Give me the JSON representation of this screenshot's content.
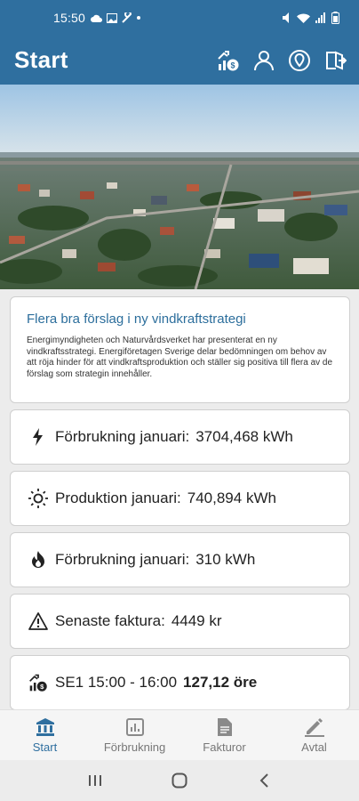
{
  "status_bar": {
    "time": "15:50",
    "left_icons": [
      "cloud-icon",
      "image-icon",
      "wrench-icon",
      "dot-icon"
    ],
    "right_icons": [
      "mute-icon",
      "wifi-icon",
      "signal-icon",
      "battery-icon"
    ]
  },
  "app_bar": {
    "title": "Start",
    "actions": [
      "price-chart-icon",
      "user-icon",
      "location-icon",
      "logout-icon"
    ]
  },
  "news": {
    "title": "Flera bra förslag i ny vindkraftstrategi",
    "body": "Energimyndigheten och Naturvårdsverket har presenterat en ny vindkraftsstrategi. Energiföretagen Sverige delar bedömningen om behov av att röja hinder för att vindkraftsproduktion och ställer sig positiva till flera av de förslag som strategin innehåller."
  },
  "cards": [
    {
      "icon": "lightning-icon",
      "label": "Förbrukning januari:",
      "value": "3704,468 kWh"
    },
    {
      "icon": "sun-icon",
      "label": "Produktion januari:",
      "value": "740,894 kWh"
    },
    {
      "icon": "flame-icon",
      "label": "Förbrukning januari:",
      "value": "310 kWh"
    },
    {
      "icon": "warning-icon",
      "label": "Senaste faktura:",
      "value": "4449 kr"
    },
    {
      "icon": "price-chart-icon",
      "label": "SE1 15:00 - 16:00",
      "value": "127,12 öre"
    }
  ],
  "bottom_nav": [
    {
      "icon": "bank-icon",
      "label": "Start",
      "active": true
    },
    {
      "icon": "chart-icon",
      "label": "Förbrukning",
      "active": false
    },
    {
      "icon": "document-icon",
      "label": "Fakturor",
      "active": false
    },
    {
      "icon": "pencil-icon",
      "label": "Avtal",
      "active": false
    }
  ],
  "colors": {
    "primary": "#2f6f9f",
    "news_title": "#2c6e9c",
    "background": "#ececec"
  }
}
